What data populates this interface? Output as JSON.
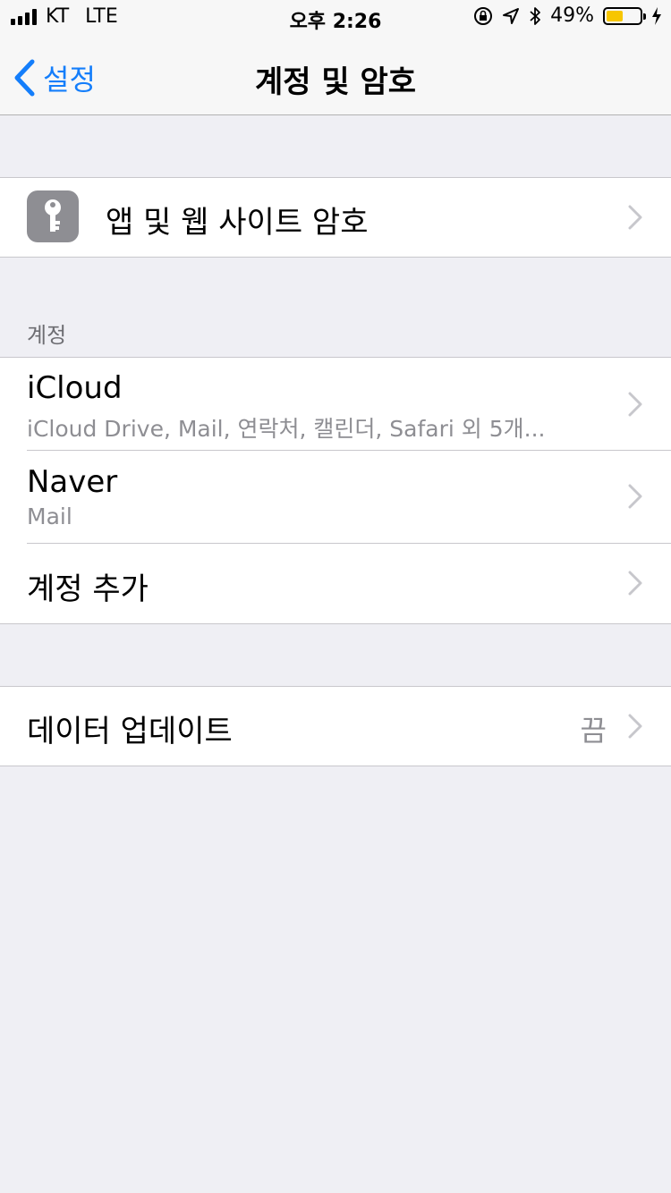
{
  "status_bar": {
    "carrier": "KT",
    "network": "LTE",
    "time": "오후 2:26",
    "battery": "49%",
    "battery_level": 0.49
  },
  "nav": {
    "back_label": "설정",
    "title": "계정 및 암호"
  },
  "passwords": {
    "label": "앱 및 웹 사이트 암호",
    "icon": "key-icon"
  },
  "accounts": {
    "header": "계정",
    "items": [
      {
        "title": "iCloud",
        "subtitle": "iCloud Drive, Mail, 연락처, 캘린더, Safari 외 5개..."
      },
      {
        "title": "Naver",
        "subtitle": "Mail"
      }
    ],
    "add_label": "계정 추가"
  },
  "fetch": {
    "label": "데이터 업데이트",
    "value": "끔"
  },
  "colors": {
    "tint": "#147efb",
    "background": "#efeff4",
    "battery_fill": "#f7c600"
  }
}
